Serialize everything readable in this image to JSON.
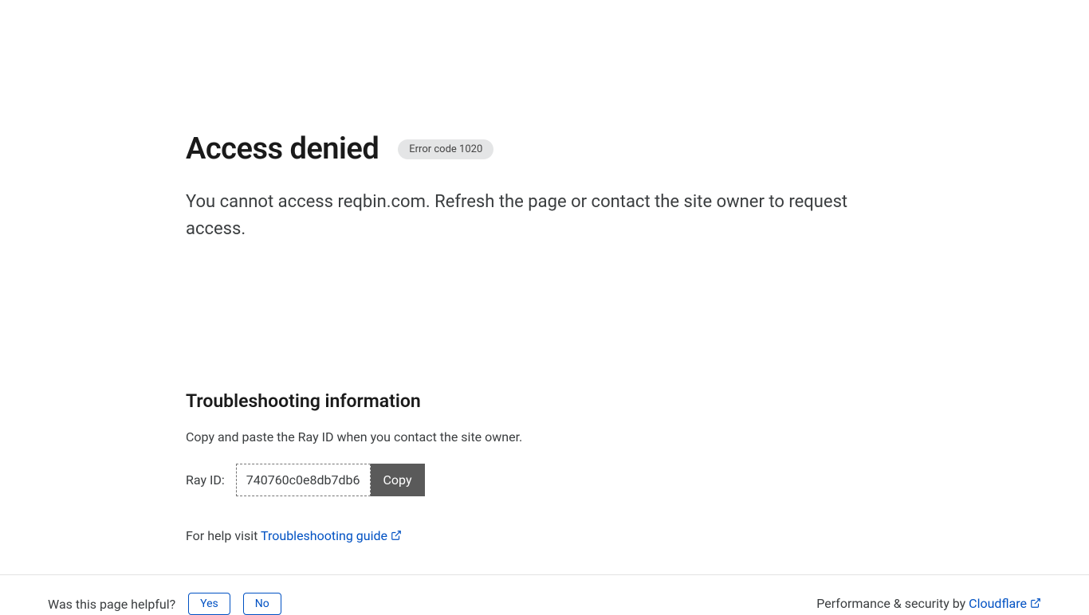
{
  "header": {
    "title": "Access denied",
    "error_badge": "Error code 1020",
    "description": "You cannot access reqbin.com. Refresh the page or contact the site owner to request access."
  },
  "troubleshooting": {
    "title": "Troubleshooting information",
    "instruction": "Copy and paste the Ray ID when you contact the site owner.",
    "ray_id_label": "Ray ID:",
    "ray_id_value": "740760c0e8db7db6",
    "copy_label": "Copy",
    "help_prefix": "For help visit ",
    "help_link": "Troubleshooting guide"
  },
  "footer": {
    "helpful_prompt": "Was this page helpful?",
    "yes_label": "Yes",
    "no_label": "No",
    "perf_prefix": "Performance & security by ",
    "cloudflare_label": "Cloudflare"
  }
}
